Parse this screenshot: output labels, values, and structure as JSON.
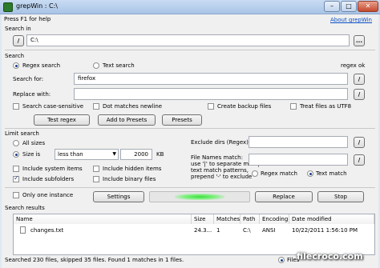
{
  "window": {
    "title": "grepWin : C:\\",
    "minimize": "–",
    "maximize": "□",
    "close": "✕"
  },
  "header": {
    "help": "Press F1 for help",
    "about": "About grepWin"
  },
  "search_in": {
    "label": "Search in",
    "value": "C:\\",
    "browse": "..."
  },
  "search": {
    "label": "Search",
    "regex_label": "Regex search",
    "text_label": "Text search",
    "regex_ok": "regex ok",
    "search_for_label": "Search for:",
    "search_for_value": "firefox",
    "replace_with_label": "Replace with:",
    "replace_with_value": "",
    "regex_help": "/"
  },
  "options": {
    "case_sensitive": "Search case-sensitive",
    "dot_newline": "Dot matches newline",
    "backup": "Create backup files",
    "utf8": "Treat files as UTF8",
    "test_regex": "Test regex",
    "add_presets": "Add to Presets",
    "presets": "Presets"
  },
  "limit": {
    "label": "Limit search",
    "all_sizes": "All sizes",
    "size_is": "Size is",
    "size_op": "less than",
    "size_value": "2000",
    "size_unit": "KB",
    "system": "Include system items",
    "hidden": "Include hidden items",
    "subfolders": "Include subfolders",
    "binary": "Include binary files",
    "exclude_dirs": "Exclude dirs (Regex):",
    "file_names_match": "File Names match:\nuse '|' to separate multiple\ntext match patterns,\nprepend '-' to exclude",
    "regex_match": "Regex match",
    "text_match": "Text match"
  },
  "actions": {
    "one_instance": "Only one instance",
    "settings": "Settings",
    "replace": "Replace",
    "stop": "Stop",
    "progress": 0.5
  },
  "results": {
    "label": "Search results",
    "columns": [
      "Name",
      "Size",
      "Matches",
      "Path",
      "Encoding",
      "Date modified"
    ],
    "rows": [
      {
        "name": "changes.txt",
        "size": "24.3...",
        "matches": "1",
        "path": "C:\\",
        "encoding": "ANSI",
        "date": "10/22/2011 1:56:10 PM"
      }
    ],
    "status": "Searched 230 files, skipped 35 files. Found 1 matches in 1 files.",
    "files_radio": "Files"
  },
  "watermark": "filecroco.com"
}
